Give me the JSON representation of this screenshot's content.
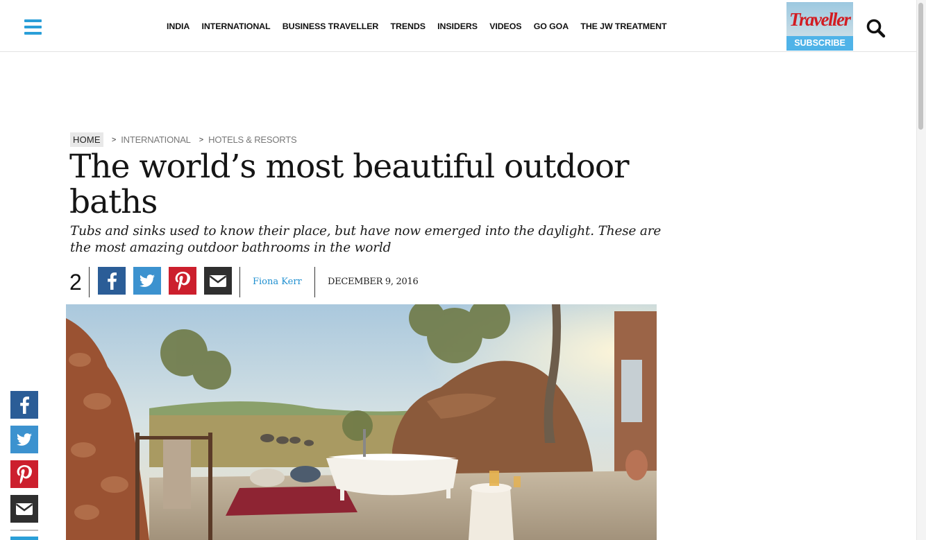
{
  "header": {
    "menu_icon": "hamburger-menu-icon",
    "nav": [
      "INDIA",
      "INTERNATIONAL",
      "BUSINESS TRAVELLER",
      "TRENDS",
      "INSIDERS",
      "VIDEOS",
      "GO GOA",
      "THE JW TREATMENT"
    ],
    "magazine_title": "Traveller",
    "subscribe_label": "SUBSCRIBE",
    "search_icon": "search-icon"
  },
  "breadcrumb": {
    "home": "HOME",
    "items": [
      "INTERNATIONAL",
      "HOTELS & RESORTS"
    ],
    "separator": ">"
  },
  "article": {
    "title": "The world’s most beautiful outdoor baths",
    "subtitle": "Tubs and sinks used to know their place, but have now emerged into the daylight. These are the most amazing outdoor bathrooms in the world",
    "share_count": "2",
    "author": "Fiona Kerr",
    "date": "DECEMBER 9, 2016"
  },
  "share": {
    "icons": [
      "facebook-icon",
      "twitter-icon",
      "pinterest-icon",
      "email-icon"
    ],
    "colors": {
      "facebook": "#2b5d97",
      "twitter": "#3c92cf",
      "pinterest": "#cc1f2d",
      "email": "#2f2f2f"
    }
  },
  "colors": {
    "accent": "#2a9fd8",
    "nav_text": "#111111",
    "author_link": "#1e8fd0"
  }
}
